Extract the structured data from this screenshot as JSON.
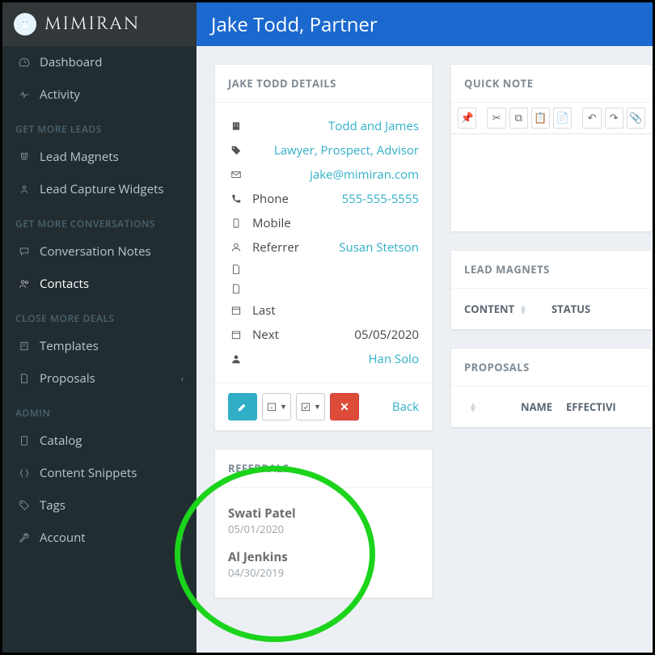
{
  "brand": "MIMIRAN",
  "page_title": "Jake Todd, Partner",
  "sidebar": {
    "top": [
      {
        "label": "Dashboard",
        "icon": "gauge-icon"
      },
      {
        "label": "Activity",
        "icon": "heartbeat-icon"
      }
    ],
    "sections": [
      {
        "header": "GET MORE LEADS",
        "items": [
          {
            "label": "Lead Magnets",
            "icon": "magnet-icon"
          },
          {
            "label": "Lead Capture Widgets",
            "icon": "person-icon"
          }
        ]
      },
      {
        "header": "GET MORE CONVERSATIONS",
        "items": [
          {
            "label": "Conversation Notes",
            "icon": "chat-icon"
          },
          {
            "label": "Contacts",
            "icon": "contacts-icon",
            "active": true
          }
        ]
      },
      {
        "header": "CLOSE MORE DEALS",
        "items": [
          {
            "label": "Templates",
            "icon": "template-icon"
          },
          {
            "label": "Proposals",
            "icon": "document-icon",
            "has_submenu": true
          }
        ]
      },
      {
        "header": "ADMIN",
        "items": [
          {
            "label": "Catalog",
            "icon": "tablet-icon"
          },
          {
            "label": "Content Snippets",
            "icon": "snippet-icon"
          },
          {
            "label": "Tags",
            "icon": "tag-icon"
          },
          {
            "label": "Account",
            "icon": "wrench-icon",
            "has_submenu": true
          }
        ]
      }
    ]
  },
  "details": {
    "header": "JAKE TODD DETAILS",
    "company": "Todd and James",
    "tags": [
      "Lawyer",
      "Prospect",
      "Advisor"
    ],
    "email": "jake@mimiran.com",
    "phone_label": "Phone",
    "phone": "555-555-5555",
    "mobile_label": "Mobile",
    "referrer_label": "Referrer",
    "referrer": "Susan Stetson",
    "last_label": "Last",
    "next_label": "Next",
    "next_date": "05/05/2020",
    "owner": "Han Solo",
    "back_label": "Back"
  },
  "referrals": {
    "header": "REFERRALS",
    "items": [
      {
        "name": "Swati Patel",
        "date": "05/01/2020"
      },
      {
        "name": "Al Jenkins",
        "date": "04/30/2019"
      }
    ]
  },
  "quick_note": {
    "header": "QUICK NOTE"
  },
  "lead_magnets": {
    "header": "LEAD MAGNETS",
    "columns": [
      "CONTENT",
      "STATUS"
    ]
  },
  "proposals": {
    "header": "PROPOSALS",
    "columns": [
      "NAME",
      "EFFECTIVI"
    ]
  }
}
